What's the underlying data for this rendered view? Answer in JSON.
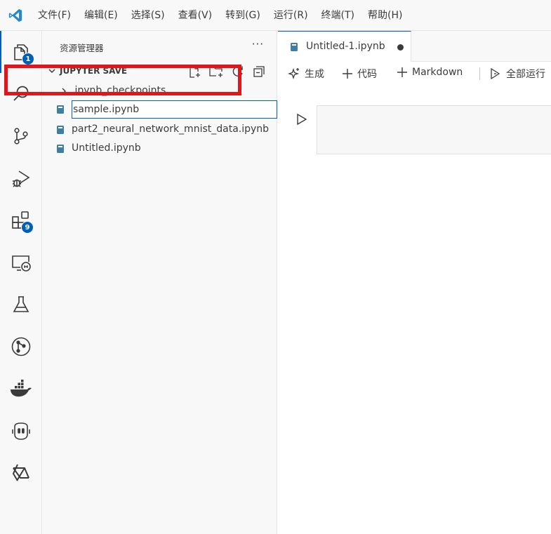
{
  "menu": [
    "文件(F)",
    "编辑(E)",
    "选择(S)",
    "查看(V)",
    "转到(G)",
    "运行(R)",
    "终端(T)",
    "帮助(H)"
  ],
  "activity": {
    "explorer_badge": "1",
    "extensions_badge": "9"
  },
  "sidebar": {
    "title": "资源管理器",
    "more": "···",
    "section_title": "JUPYTER SAVE",
    "items": [
      {
        "label": ".ipynb_checkpoints",
        "type": "folder"
      },
      {
        "label": "part2_neural_network_mnist_data.ipynb",
        "type": "notebook"
      },
      {
        "label": "Untitled.ipynb",
        "type": "notebook"
      }
    ],
    "rename_value": "sample.ipynb"
  },
  "editor": {
    "tab_label": "Untitled-1.ipynb",
    "toolbar": {
      "generate": "生成",
      "code": "代码",
      "markdown": "Markdown",
      "run_all": "全部运行"
    }
  },
  "colors": {
    "accent": "#005fb8",
    "highlight": "#e0161b",
    "notebook_icon": "#3e7ea3"
  }
}
